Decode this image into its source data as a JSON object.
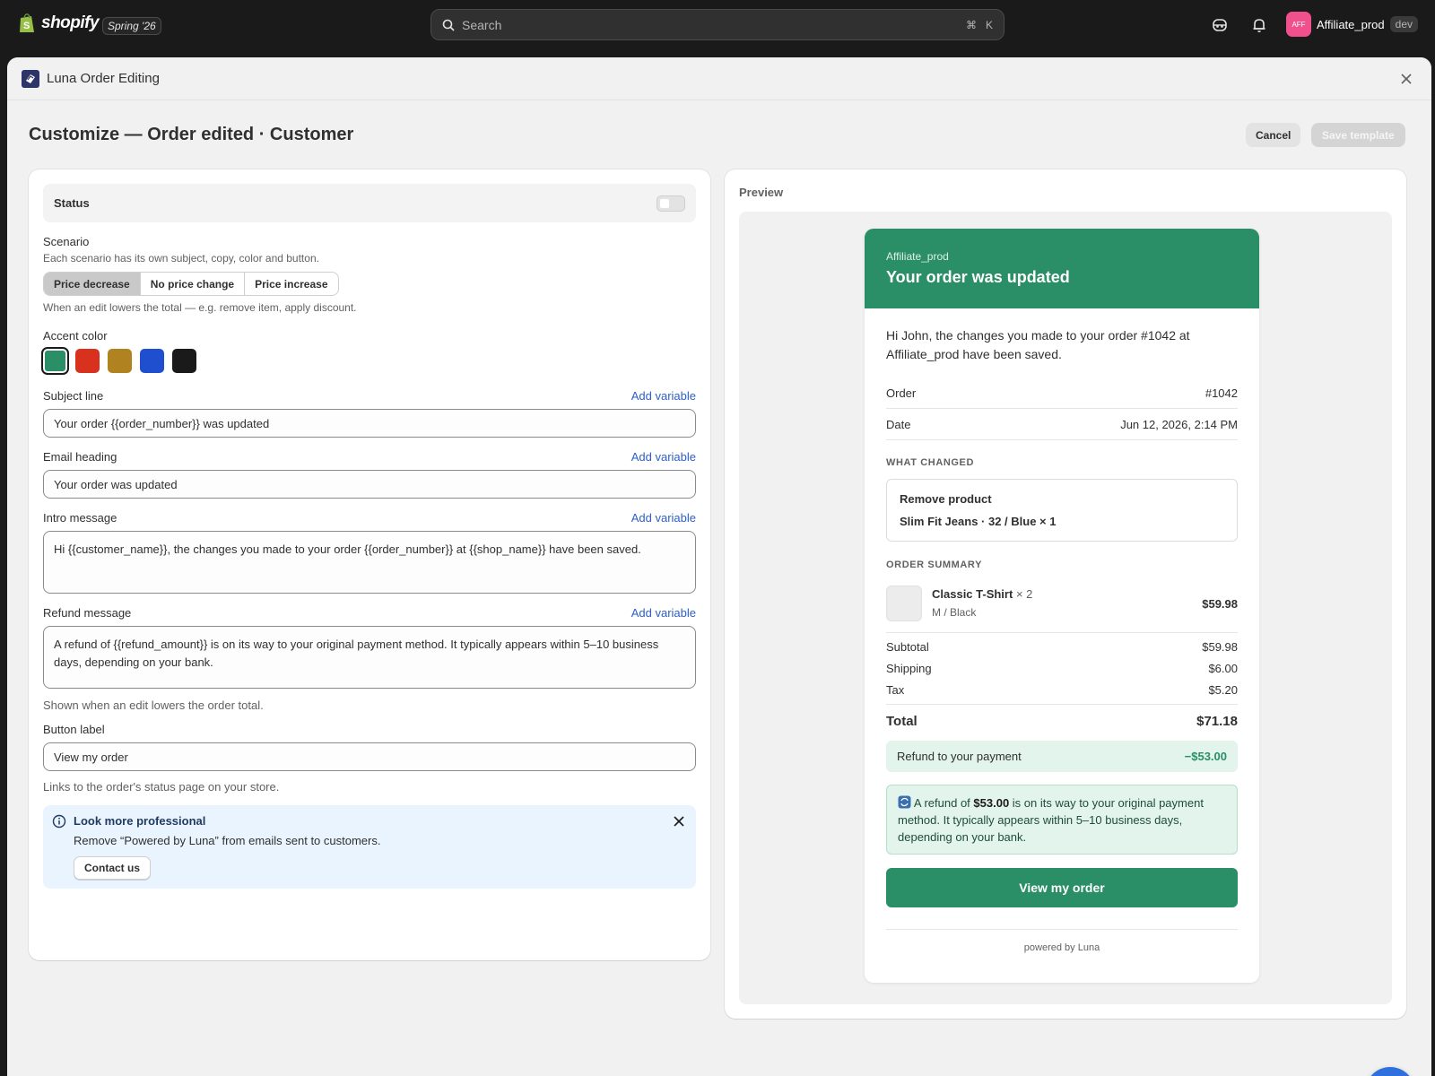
{
  "topbar": {
    "brand": "shopify",
    "edition": "Spring '26",
    "search_placeholder": "Search",
    "search_shortcut_cmd": "⌘",
    "search_shortcut_key": "K",
    "account_initials": "AFF",
    "account_name": "Affiliate_prod",
    "account_badge": "dev"
  },
  "modal": {
    "app_title": "Luna Order Editing",
    "page_title": "Customize — Order edited · Customer",
    "cancel_label": "Cancel",
    "save_label": "Save template"
  },
  "form": {
    "status_label": "Status",
    "scenario_label": "Scenario",
    "scenario_help": "Each scenario has its own subject, copy, color and button.",
    "scenarios": [
      "Price decrease",
      "No price change",
      "Price increase"
    ],
    "scenario_selected": "Price decrease",
    "scenario_desc": "When an edit lowers the total — e.g. remove item, apply discount.",
    "accent_label": "Accent color",
    "accent_colors": [
      "#2a8e66",
      "#d8321f",
      "#b08320",
      "#1f4fcf",
      "#1a1a1a"
    ],
    "add_variable": "Add variable",
    "subject_label": "Subject line",
    "subject_value": "Your order {{order_number}} was updated",
    "heading_label": "Email heading",
    "heading_value": "Your order was updated",
    "intro_label": "Intro message",
    "intro_value": "Hi {{customer_name}}, the changes you made to your order {{order_number}} at {{shop_name}} have been saved.",
    "refund_label": "Refund message",
    "refund_value": "A refund of {{refund_amount}} is on its way to your original payment method. It typically appears within 5–10 business days, depending on your bank.",
    "refund_help": "Shown when an edit lowers the order total.",
    "button_label_label": "Button label",
    "button_label_value": "View my order",
    "button_label_help": "Links to the order's status page on your store."
  },
  "banner": {
    "title": "Look more professional",
    "body": "Remove “Powered by Luna” from emails sent to customers.",
    "button": "Contact us"
  },
  "preview": {
    "label": "Preview",
    "accent": "#2a8e66",
    "shop": "Affiliate_prod",
    "heading": "Your order was updated",
    "greeting": "Hi John, the changes you made to your order #1042 at Affiliate_prod have been saved.",
    "order_label": "Order",
    "order_value": "#1042",
    "date_label": "Date",
    "date_value": "Jun 12, 2026, 2:14 PM",
    "what_changed": "WHAT CHANGED",
    "change_action": "Remove product",
    "change_item": "Slim Fit Jeans · 32 / Blue × 1",
    "summary_title": "ORDER SUMMARY",
    "item_name": "Classic T-Shirt",
    "item_qty": "× 2",
    "item_variant": "M / Black",
    "item_price": "$59.98",
    "subtotal_label": "Subtotal",
    "subtotal_value": "$59.98",
    "shipping_label": "Shipping",
    "shipping_value": "$6.00",
    "tax_label": "Tax",
    "tax_value": "$5.20",
    "total_label": "Total",
    "total_value": "$71.18",
    "refund_label": "Refund to your payment",
    "refund_value": "−$53.00",
    "notice_pre": "A refund of ",
    "notice_amount": "$53.00",
    "notice_post": " is on its way to your original payment method. It typically appears within 5–10 business days, depending on your bank.",
    "button": "View my order",
    "powered": "powered by Luna"
  }
}
